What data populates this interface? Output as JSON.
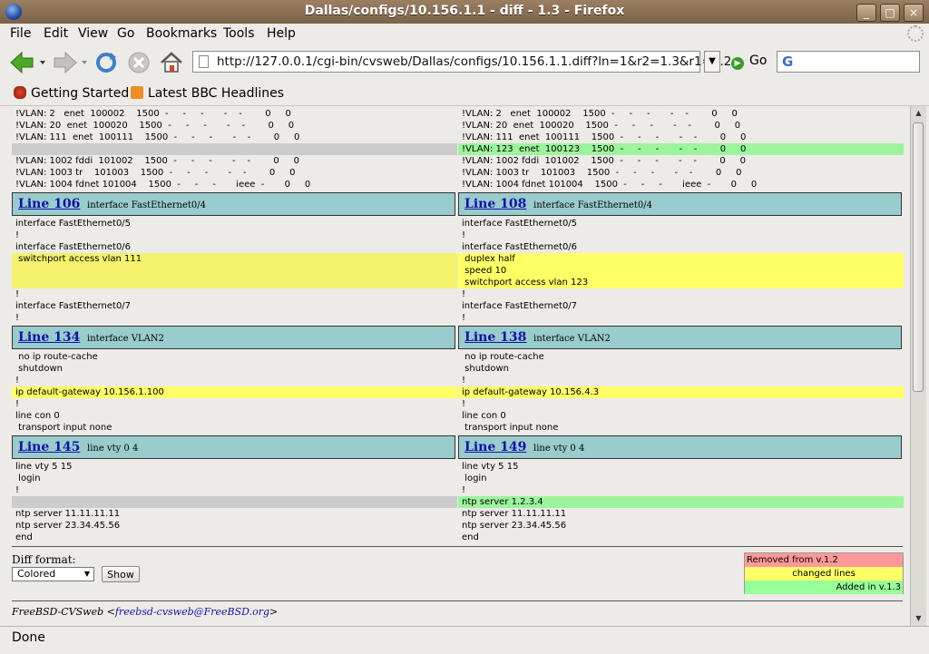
{
  "window": {
    "title": "Dallas/configs/10.156.1.1 - diff - 1.3 - Firefox"
  },
  "menu": [
    "File",
    "Edit",
    "View",
    "Go",
    "Bookmarks",
    "Tools",
    "Help"
  ],
  "toolbar": {
    "url": "http://127.0.0.1/cgi-bin/cvsweb/Dallas/configs/10.156.1.1.diff?ln=1&r2=1.3&r1=1.2",
    "go_label": "Go",
    "search_value": ""
  },
  "bookmarks": [
    "Getting Started",
    "Latest BBC Headlines"
  ],
  "diff": {
    "left_lines": [
      {
        "t": "!VLAN: 2   enet  100002    1500  -     -     -       -    -        0     0",
        "c": ""
      },
      {
        "t": "!VLAN: 20  enet  100020    1500  -     -     -       -    -        0     0",
        "c": ""
      },
      {
        "t": "!VLAN: 111  enet  100111    1500  -     -     -       -    -        0     0",
        "c": ""
      },
      {
        "t": "",
        "c": "gray"
      },
      {
        "t": "!VLAN: 1002 fddi  101002    1500  -     -     -       -    -        0     0",
        "c": ""
      },
      {
        "t": "!VLAN: 1003 tr    101003    1500  -     -     -       -    -        0     0",
        "c": ""
      },
      {
        "t": "!VLAN: 1004 fdnet 101004    1500  -     -     -       ieee  -       0     0",
        "c": ""
      }
    ],
    "right_lines": [
      {
        "t": "!VLAN: 2   enet  100002    1500  -     -     -       -    -        0     0",
        "c": ""
      },
      {
        "t": "!VLAN: 20  enet  100020    1500  -     -     -       -    -        0     0",
        "c": ""
      },
      {
        "t": "!VLAN: 111  enet  100111    1500  -     -     -       -    -        0     0",
        "c": ""
      },
      {
        "t": "!VLAN: 123  enet  100123    1500  -     -     -       -    -        0     0",
        "c": "add"
      },
      {
        "t": "!VLAN: 1002 fddi  101002    1500  -     -     -       -    -        0     0",
        "c": ""
      },
      {
        "t": "!VLAN: 1003 tr    101003    1500  -     -     -       -    -        0     0",
        "c": ""
      },
      {
        "t": "!VLAN: 1004 fdnet 101004    1500  -     -     -       ieee  -       0     0",
        "c": ""
      }
    ],
    "hunks": [
      {
        "left_link": "Line 106",
        "left_sig": "interface FastEthernet0/4",
        "right_link": "Line 108",
        "right_sig": "interface FastEthernet0/4",
        "left": [
          {
            "t": "interface FastEthernet0/5",
            "c": ""
          },
          {
            "t": "!",
            "c": ""
          },
          {
            "t": "interface FastEthernet0/6",
            "c": ""
          },
          {
            "t": " switchport access vlan 111",
            "c": "chg"
          },
          {
            "t": "",
            "c": "chg"
          },
          {
            "t": "",
            "c": "chg"
          },
          {
            "t": "!",
            "c": ""
          },
          {
            "t": "interface FastEthernet0/7",
            "c": ""
          },
          {
            "t": "!",
            "c": ""
          }
        ],
        "right": [
          {
            "t": "interface FastEthernet0/5",
            "c": ""
          },
          {
            "t": "!",
            "c": ""
          },
          {
            "t": "interface FastEthernet0/6",
            "c": ""
          },
          {
            "t": " duplex half",
            "c": "chgR"
          },
          {
            "t": " speed 10",
            "c": "chgR"
          },
          {
            "t": " switchport access vlan 123",
            "c": "chgR"
          },
          {
            "t": "!",
            "c": ""
          },
          {
            "t": "interface FastEthernet0/7",
            "c": ""
          },
          {
            "t": "!",
            "c": ""
          }
        ]
      },
      {
        "left_link": "Line 134",
        "left_sig": "interface VLAN2",
        "right_link": "Line 138",
        "right_sig": "interface VLAN2",
        "left": [
          {
            "t": " no ip route-cache",
            "c": ""
          },
          {
            "t": " shutdown",
            "c": ""
          },
          {
            "t": "!",
            "c": ""
          },
          {
            "t": "ip default-gateway 10.156.1.100",
            "c": "chgR"
          },
          {
            "t": "!",
            "c": ""
          },
          {
            "t": "line con 0",
            "c": ""
          },
          {
            "t": " transport input none",
            "c": ""
          }
        ],
        "right": [
          {
            "t": " no ip route-cache",
            "c": ""
          },
          {
            "t": " shutdown",
            "c": ""
          },
          {
            "t": "!",
            "c": ""
          },
          {
            "t": "ip default-gateway 10.156.4.3",
            "c": "chgR"
          },
          {
            "t": "!",
            "c": ""
          },
          {
            "t": "line con 0",
            "c": ""
          },
          {
            "t": " transport input none",
            "c": ""
          }
        ]
      },
      {
        "left_link": "Line 145",
        "left_sig": "line vty 0 4",
        "right_link": "Line 149",
        "right_sig": "line vty 0 4",
        "left": [
          {
            "t": "line vty 5 15",
            "c": ""
          },
          {
            "t": " login",
            "c": ""
          },
          {
            "t": "!",
            "c": ""
          },
          {
            "t": "",
            "c": "gray"
          },
          {
            "t": "ntp server 11.11.11.11",
            "c": ""
          },
          {
            "t": "ntp server 23.34.45.56",
            "c": ""
          },
          {
            "t": "end",
            "c": ""
          }
        ],
        "right": [
          {
            "t": "line vty 5 15",
            "c": ""
          },
          {
            "t": " login",
            "c": ""
          },
          {
            "t": "!",
            "c": ""
          },
          {
            "t": "ntp server 1.2.3.4",
            "c": "add"
          },
          {
            "t": "ntp server 11.11.11.11",
            "c": ""
          },
          {
            "t": "ntp server 23.34.45.56",
            "c": ""
          },
          {
            "t": "end",
            "c": ""
          }
        ]
      }
    ]
  },
  "form": {
    "label": "Diff format:",
    "select_value": "Colored",
    "show_label": "Show"
  },
  "legend": {
    "removed": "Removed from v.1.2",
    "changed": "changed lines",
    "added": "Added in v.1.3"
  },
  "footer": {
    "prefix": "FreeBSD-CVSweb <",
    "email": "freebsd-cvsweb@FreeBSD.org",
    "suffix": ">"
  },
  "status": "Done",
  "colors": {
    "changed": "#ffff66",
    "added": "#99ff99",
    "removed": "#ff9999",
    "header": "#99cccc",
    "gray": "#cccccc"
  }
}
